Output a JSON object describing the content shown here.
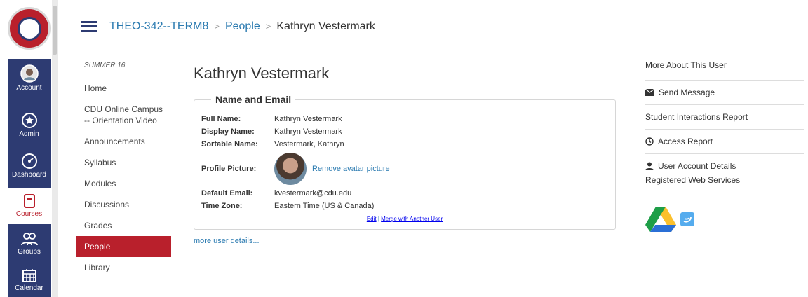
{
  "global_nav": {
    "items": [
      {
        "label": "Account",
        "icon": "account-avatar-icon"
      },
      {
        "label": "Admin",
        "icon": "shield-star-icon"
      },
      {
        "label": "Dashboard",
        "icon": "speedometer-icon"
      },
      {
        "label": "Courses",
        "icon": "book-icon"
      },
      {
        "label": "Groups",
        "icon": "people-icon"
      },
      {
        "label": "Calendar",
        "icon": "calendar-icon"
      }
    ],
    "active": "Courses"
  },
  "breadcrumb": {
    "course": "THEO-342--TERM8",
    "section": "People",
    "current": "Kathryn Vestermark"
  },
  "course_nav": {
    "term": "SUMMER 16",
    "items": [
      "Home",
      "CDU Online Campus -- Orientation Video",
      "Announcements",
      "Syllabus",
      "Modules",
      "Discussions",
      "Grades",
      "People",
      "Library"
    ],
    "active": "People"
  },
  "profile": {
    "name": "Kathryn Vestermark",
    "section_title": "Name and Email",
    "labels": {
      "full_name": "Full Name:",
      "display_name": "Display Name:",
      "sortable_name": "Sortable Name:",
      "profile_picture": "Profile Picture:",
      "default_email": "Default Email:",
      "time_zone": "Time Zone:"
    },
    "full_name": "Kathryn Vestermark",
    "display_name": "Kathryn Vestermark",
    "sortable_name": "Vestermark, Kathryn",
    "remove_avatar": "Remove avatar picture",
    "default_email": "kvestermark@cdu.edu",
    "time_zone": "Eastern Time (US & Canada)",
    "edit": "Edit",
    "merge": "Merge with Another User",
    "more_details": "more user details..."
  },
  "aside": {
    "title": "More About This User",
    "links": [
      {
        "label": "Send Message",
        "icon": "envelope-icon"
      },
      {
        "label": "Student Interactions Report",
        "icon": ""
      },
      {
        "label": "Access Report",
        "icon": "clock-icon"
      },
      {
        "label": "User Account Details",
        "icon": "user-icon"
      }
    ],
    "services_title": "Registered Web Services",
    "services": [
      {
        "name": "google-drive-icon"
      },
      {
        "name": "twitter-icon"
      }
    ]
  },
  "colors": {
    "nav_bg": "#2d3b72",
    "accent_red": "#b9202c",
    "link_blue": "#2a7ab0"
  }
}
